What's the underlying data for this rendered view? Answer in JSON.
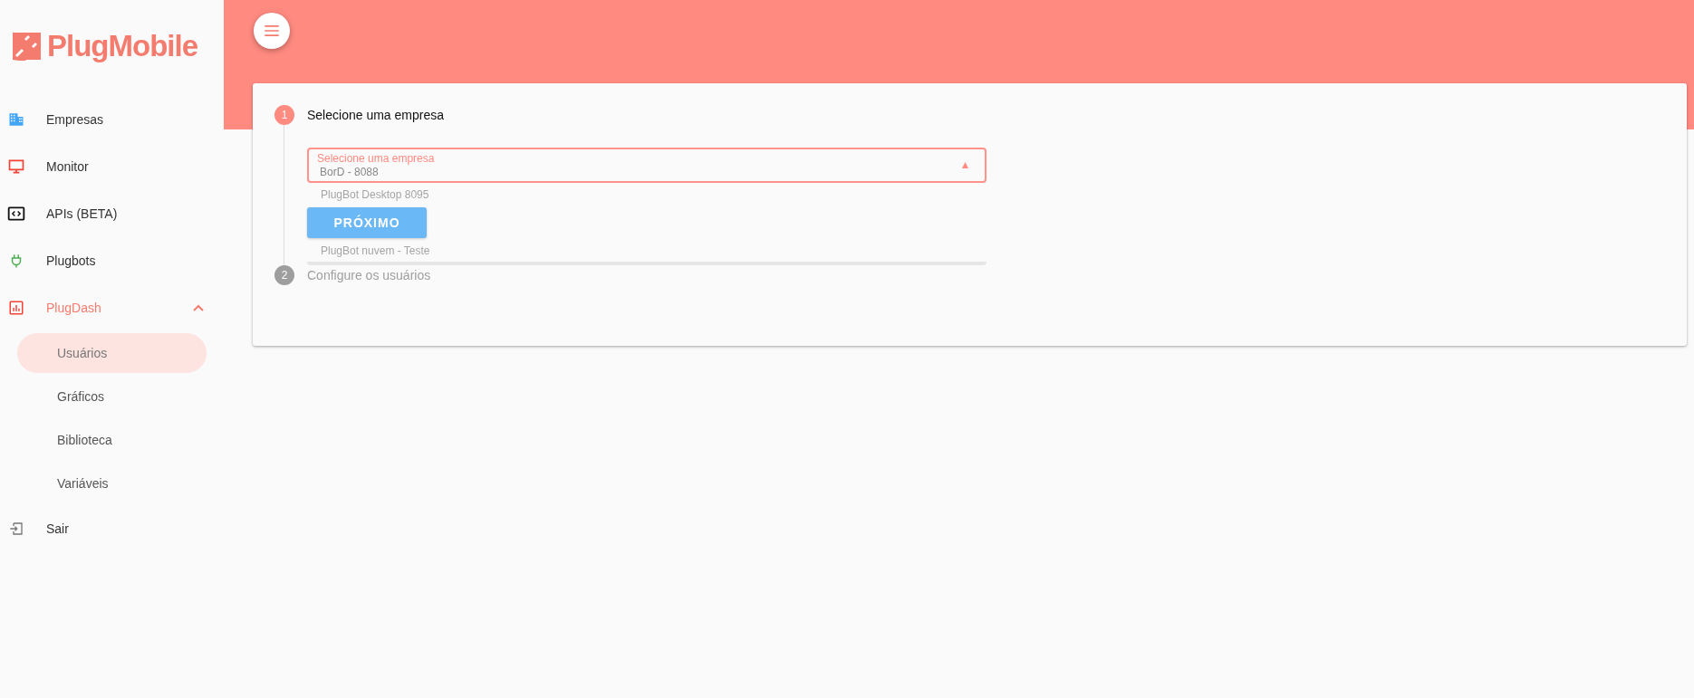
{
  "logo": {
    "text": "PlugMobile"
  },
  "sidebar": {
    "items": [
      {
        "label": "Empresas",
        "selected": false
      },
      {
        "label": "Monitor",
        "selected": false
      },
      {
        "label": "APIs (BETA)",
        "selected": false
      },
      {
        "label": "Plugbots",
        "selected": false
      },
      {
        "label": "PlugDash",
        "selected": true,
        "expanded": true,
        "children": [
          {
            "label": "Usuários",
            "selected": true
          },
          {
            "label": "Gráficos",
            "selected": false
          },
          {
            "label": "Biblioteca",
            "selected": false
          },
          {
            "label": "Variáveis",
            "selected": false
          }
        ]
      },
      {
        "label": "Sair",
        "selected": false
      }
    ]
  },
  "stepper": {
    "steps": [
      {
        "number": "1",
        "title": "Selecione uma empresa",
        "active": true
      },
      {
        "number": "2",
        "title": "Configure os usuários",
        "active": false
      }
    ]
  },
  "select": {
    "label": "Selecione uma empresa",
    "value": "BorD - 8088",
    "open": true,
    "options": [
      "PlugBot Desktop 8095",
      "PlugBot nuvem - Teste"
    ]
  },
  "next_button": {
    "label": "PRÓXIMO"
  }
}
